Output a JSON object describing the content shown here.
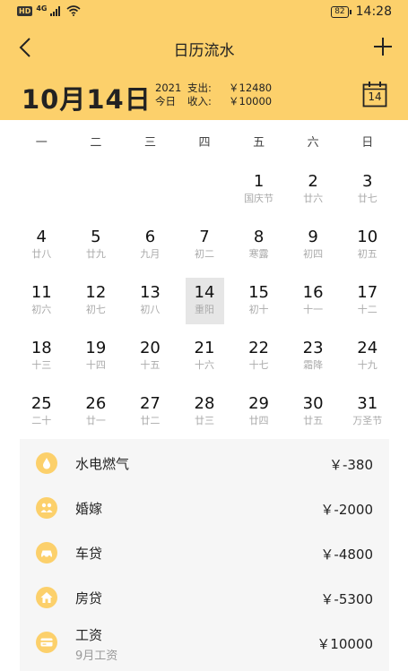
{
  "status_bar": {
    "hd": "HD",
    "network": "4G",
    "battery": "82",
    "time": "14:28"
  },
  "nav": {
    "title": "日历流水"
  },
  "summary": {
    "date": "10月14日",
    "year": "2021",
    "today_label": "今日",
    "expense_label": "支出:",
    "expense_value": "￥12480",
    "income_label": "收入:",
    "income_value": "￥10000",
    "calendar_day": "14"
  },
  "weekdays": [
    "一",
    "二",
    "三",
    "四",
    "五",
    "六",
    "日"
  ],
  "calendar": {
    "leading_blanks": 4,
    "selected_day": "14",
    "days": [
      {
        "num": "1",
        "lunar": "国庆节"
      },
      {
        "num": "2",
        "lunar": "廿六"
      },
      {
        "num": "3",
        "lunar": "廿七"
      },
      {
        "num": "4",
        "lunar": "廿八"
      },
      {
        "num": "5",
        "lunar": "廿九"
      },
      {
        "num": "6",
        "lunar": "九月"
      },
      {
        "num": "7",
        "lunar": "初二"
      },
      {
        "num": "8",
        "lunar": "寒露"
      },
      {
        "num": "9",
        "lunar": "初四"
      },
      {
        "num": "10",
        "lunar": "初五"
      },
      {
        "num": "11",
        "lunar": "初六"
      },
      {
        "num": "12",
        "lunar": "初七"
      },
      {
        "num": "13",
        "lunar": "初八"
      },
      {
        "num": "14",
        "lunar": "重阳"
      },
      {
        "num": "15",
        "lunar": "初十"
      },
      {
        "num": "16",
        "lunar": "十一"
      },
      {
        "num": "17",
        "lunar": "十二"
      },
      {
        "num": "18",
        "lunar": "十三"
      },
      {
        "num": "19",
        "lunar": "十四"
      },
      {
        "num": "20",
        "lunar": "十五"
      },
      {
        "num": "21",
        "lunar": "十六"
      },
      {
        "num": "22",
        "lunar": "十七"
      },
      {
        "num": "23",
        "lunar": "霜降"
      },
      {
        "num": "24",
        "lunar": "十九"
      },
      {
        "num": "25",
        "lunar": "二十"
      },
      {
        "num": "26",
        "lunar": "廿一"
      },
      {
        "num": "27",
        "lunar": "廿二"
      },
      {
        "num": "28",
        "lunar": "廿三"
      },
      {
        "num": "29",
        "lunar": "廿四"
      },
      {
        "num": "30",
        "lunar": "廿五"
      },
      {
        "num": "31",
        "lunar": "万圣节"
      }
    ]
  },
  "transactions": [
    {
      "icon": "utilities-icon",
      "name": "水电燃气",
      "note": "",
      "amount": "￥-380"
    },
    {
      "icon": "wedding-icon",
      "name": "婚嫁",
      "note": "",
      "amount": "￥-2000"
    },
    {
      "icon": "car-loan-icon",
      "name": "车贷",
      "note": "",
      "amount": "￥-4800"
    },
    {
      "icon": "mortgage-icon",
      "name": "房贷",
      "note": "",
      "amount": "￥-5300"
    },
    {
      "icon": "salary-icon",
      "name": "工资",
      "note": "9月工资",
      "amount": "￥10000"
    }
  ],
  "colors": {
    "header_bg": "#FCD06B",
    "selected_bg": "#E6E6E6",
    "list_bg": "#F6F6F6",
    "icon_bg": "#FCD06B"
  }
}
